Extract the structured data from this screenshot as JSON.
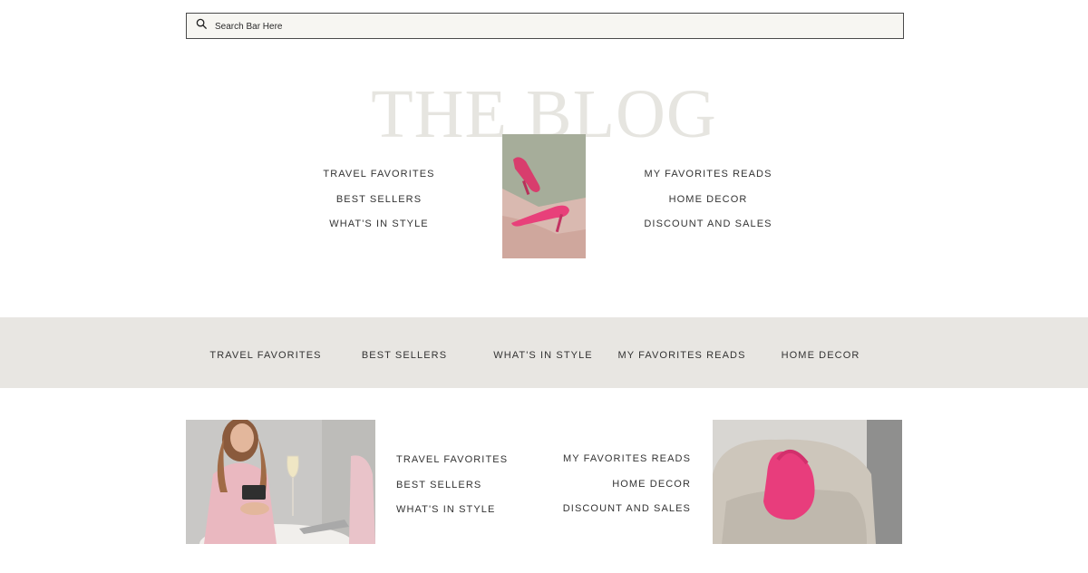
{
  "search": {
    "placeholder": "Search Bar Here"
  },
  "hero": {
    "title": "THE BLOG",
    "left_links": [
      "TRAVEL FAVORITES",
      "BEST SELLERS",
      "WHAT'S IN STYLE"
    ],
    "right_links": [
      "MY FAVORITES READS",
      "HOME DECOR",
      "DISCOUNT AND SALES"
    ]
  },
  "band_nav": {
    "links": [
      "TRAVEL FAVORITES",
      "BEST SELLERS",
      "WHAT'S IN STYLE",
      "MY FAVORITES READS",
      "HOME DECOR"
    ]
  },
  "bottom": {
    "left_links": [
      "TRAVEL FAVORITES",
      "BEST SELLERS",
      "WHAT'S IN STYLE"
    ],
    "right_links": [
      "MY FAVORITES READS",
      "HOME DECOR",
      "DISCOUNT AND SALES"
    ]
  },
  "colors": {
    "band": "#e8e6e2",
    "title": "#e6e5e0",
    "accent_pink": "#e8407a"
  }
}
